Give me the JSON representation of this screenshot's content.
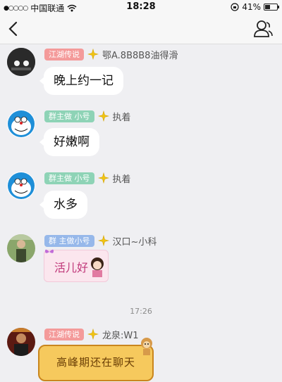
{
  "status_bar": {
    "signal_dots": "●○○○○",
    "carrier": "中国联通",
    "time": "18:28",
    "battery_percent": "41%",
    "battery_level": 0.41
  },
  "nav": {
    "back_icon": "chevron-left-icon",
    "profile_icon": "person-icon"
  },
  "messages": [
    {
      "tag": "江湖传说",
      "tag_color": "#f49a9a",
      "nickname": "鄂A.8B8B8油得滑",
      "text": "晚上约一记"
    },
    {
      "tag": "群主做 小号",
      "tag_color": "#8ed3b6",
      "nickname": "执着",
      "text": "好嫩啊"
    },
    {
      "tag": "群主做 小号",
      "tag_color": "#8ed3b6",
      "nickname": "执着",
      "text": "水多"
    },
    {
      "tag": "群 主做小号",
      "tag_color": "#96b8ea",
      "nickname": "汉口~小科",
      "text": "活儿好"
    },
    {
      "tag": "江湖传说",
      "tag_color": "#f49a9a",
      "nickname": "龙泉:W1",
      "text": "高峰期还在聊天"
    }
  ],
  "time_separator": "17:26"
}
